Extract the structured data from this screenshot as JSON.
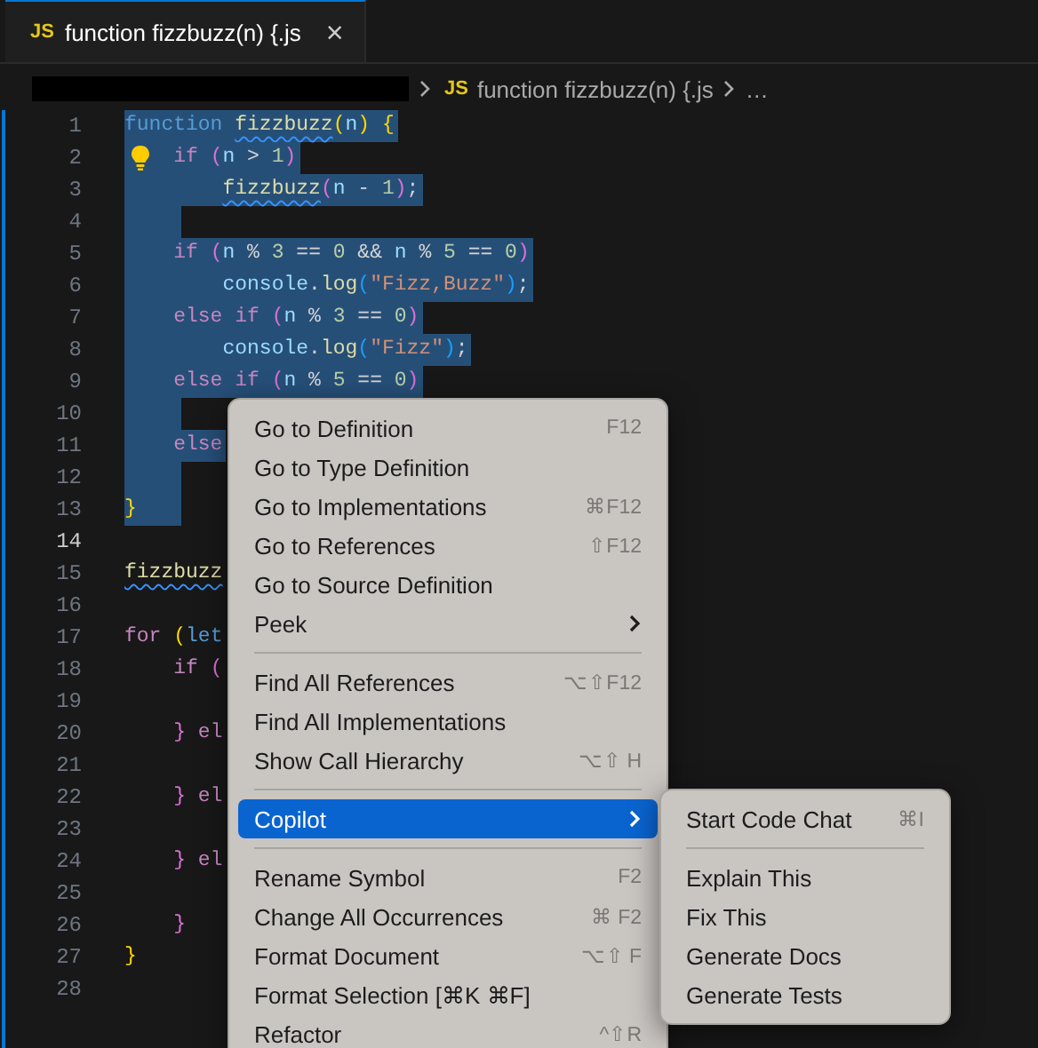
{
  "tab": {
    "icon": "JS",
    "title": "function fizzbuzz(n) {.js",
    "close": "×",
    "selected": true
  },
  "breadcrumbs": {
    "redacted": true,
    "icon": "JS",
    "file": "function fizzbuzz(n) {.js",
    "more": "…"
  },
  "lines": [
    {
      "number": "1",
      "selected": true,
      "current": false,
      "tokens": [
        {
          "text": "function ",
          "kind": "kw"
        },
        {
          "text": "fizzbuzz",
          "kind": "fn",
          "squiggle": true
        },
        {
          "text": "(",
          "kind": "p1"
        },
        {
          "text": "n",
          "kind": "var"
        },
        {
          "text": ") ",
          "kind": "p1"
        },
        {
          "text": "{",
          "kind": "p1"
        }
      ]
    },
    {
      "number": "2",
      "selected": true,
      "current": false,
      "lightbulb": true,
      "tokens": [
        {
          "text": "    if",
          "kind": "ctl"
        },
        {
          "text": " (",
          "kind": "p2"
        },
        {
          "text": "n",
          "kind": "var"
        },
        {
          "text": " > ",
          "kind": "op"
        },
        {
          "text": "1",
          "kind": "num"
        },
        {
          "text": ")",
          "kind": "p2"
        }
      ]
    },
    {
      "number": "3",
      "selected": true,
      "current": false,
      "tokens": [
        {
          "text": "        fizzbuzz",
          "kind": "fn",
          "squiggle": true
        },
        {
          "text": "(",
          "kind": "p2"
        },
        {
          "text": "n",
          "kind": "var"
        },
        {
          "text": " - ",
          "kind": "op"
        },
        {
          "text": "1",
          "kind": "num"
        },
        {
          "text": ")",
          "kind": "p2"
        },
        {
          "text": ";",
          "kind": "op"
        }
      ]
    },
    {
      "number": "4",
      "selected": true,
      "current": false
    },
    {
      "number": "5",
      "selected": true,
      "current": false,
      "tokens": [
        {
          "text": "    if",
          "kind": "ctl"
        },
        {
          "text": " (",
          "kind": "p2"
        },
        {
          "text": "n",
          "kind": "var"
        },
        {
          "text": " % ",
          "kind": "op"
        },
        {
          "text": "3",
          "kind": "num"
        },
        {
          "text": " == ",
          "kind": "op"
        },
        {
          "text": "0",
          "kind": "num"
        },
        {
          "text": " && ",
          "kind": "op"
        },
        {
          "text": "n",
          "kind": "var"
        },
        {
          "text": " % ",
          "kind": "op"
        },
        {
          "text": "5",
          "kind": "num"
        },
        {
          "text": " == ",
          "kind": "op"
        },
        {
          "text": "0",
          "kind": "num"
        },
        {
          "text": ")",
          "kind": "p2"
        }
      ]
    },
    {
      "number": "6",
      "selected": true,
      "current": false,
      "tokens": [
        {
          "text": "        console",
          "kind": "var"
        },
        {
          "text": ".",
          "kind": "op"
        },
        {
          "text": "log",
          "kind": "fn"
        },
        {
          "text": "(",
          "kind": "p3"
        },
        {
          "text": "\"Fizz,Buzz\"",
          "kind": "str"
        },
        {
          "text": ")",
          "kind": "p3"
        },
        {
          "text": ";",
          "kind": "op"
        }
      ]
    },
    {
      "number": "7",
      "selected": true,
      "current": false,
      "tokens": [
        {
          "text": "    else if",
          "kind": "ctl"
        },
        {
          "text": " (",
          "kind": "p2"
        },
        {
          "text": "n",
          "kind": "var"
        },
        {
          "text": " % ",
          "kind": "op"
        },
        {
          "text": "3",
          "kind": "num"
        },
        {
          "text": " == ",
          "kind": "op"
        },
        {
          "text": "0",
          "kind": "num"
        },
        {
          "text": ")",
          "kind": "p2"
        }
      ]
    },
    {
      "number": "8",
      "selected": true,
      "current": false,
      "tokens": [
        {
          "text": "        console",
          "kind": "var"
        },
        {
          "text": ".",
          "kind": "op"
        },
        {
          "text": "log",
          "kind": "fn"
        },
        {
          "text": "(",
          "kind": "p3"
        },
        {
          "text": "\"Fizz\"",
          "kind": "str"
        },
        {
          "text": ")",
          "kind": "p3"
        },
        {
          "text": ";",
          "kind": "op"
        }
      ]
    },
    {
      "number": "9",
      "selected": true,
      "current": false,
      "tokens": [
        {
          "text": "    else if",
          "kind": "ctl"
        },
        {
          "text": " (",
          "kind": "p2"
        },
        {
          "text": "n",
          "kind": "var"
        },
        {
          "text": " % ",
          "kind": "op"
        },
        {
          "text": "5",
          "kind": "num"
        },
        {
          "text": " == ",
          "kind": "op"
        },
        {
          "text": "0",
          "kind": "num"
        },
        {
          "text": ")",
          "kind": "p2"
        }
      ]
    },
    {
      "number": "10",
      "selected": true,
      "current": false
    },
    {
      "number": "11",
      "selected": true,
      "current": false,
      "tokens": [
        {
          "text": "    else",
          "kind": "ctl"
        }
      ]
    },
    {
      "number": "12",
      "selected": true,
      "current": false
    },
    {
      "number": "13",
      "selected": true,
      "current": false,
      "tokens": [
        {
          "text": "}",
          "kind": "p1"
        }
      ]
    },
    {
      "number": "14",
      "selected": false,
      "current": true
    },
    {
      "number": "15",
      "selected": false,
      "current": false,
      "tokens": [
        {
          "text": "fizzbuzz",
          "kind": "fn",
          "squiggle": true
        }
      ]
    },
    {
      "number": "16",
      "selected": false,
      "current": false
    },
    {
      "number": "17",
      "selected": false,
      "current": false,
      "tokens": [
        {
          "text": "for",
          "kind": "ctl"
        },
        {
          "text": " (",
          "kind": "p1"
        },
        {
          "text": "let",
          "kind": "kw"
        }
      ]
    },
    {
      "number": "18",
      "selected": false,
      "current": false,
      "tokens": [
        {
          "text": "    if",
          "kind": "ctl"
        },
        {
          "text": " (",
          "kind": "p2"
        }
      ]
    },
    {
      "number": "19",
      "selected": false,
      "current": false
    },
    {
      "number": "20",
      "selected": false,
      "current": false,
      "tokens": [
        {
          "text": "    }",
          "kind": "p2"
        },
        {
          "text": " el",
          "kind": "ctl"
        }
      ]
    },
    {
      "number": "21",
      "selected": false,
      "current": false
    },
    {
      "number": "22",
      "selected": false,
      "current": false,
      "tokens": [
        {
          "text": "    }",
          "kind": "p2"
        },
        {
          "text": " el",
          "kind": "ctl"
        }
      ]
    },
    {
      "number": "23",
      "selected": false,
      "current": false
    },
    {
      "number": "24",
      "selected": false,
      "current": false,
      "tokens": [
        {
          "text": "    }",
          "kind": "p2"
        },
        {
          "text": " el",
          "kind": "ctl"
        }
      ]
    },
    {
      "number": "25",
      "selected": false,
      "current": false
    },
    {
      "number": "26",
      "selected": false,
      "current": false,
      "tokens": [
        {
          "text": "    }",
          "kind": "p2"
        }
      ]
    },
    {
      "number": "27",
      "selected": false,
      "current": false,
      "tokens": [
        {
          "text": "}",
          "kind": "p1"
        }
      ]
    },
    {
      "number": "28",
      "selected": false,
      "current": false
    }
  ],
  "context_menu": {
    "items": [
      {
        "kind": "item",
        "label": "Go to Definition",
        "shortcut": "F12",
        "selected": false
      },
      {
        "kind": "item",
        "label": "Go to Type Definition",
        "selected": false
      },
      {
        "kind": "item",
        "label": "Go to Implementations",
        "shortcut": "⌘F12",
        "selected": false
      },
      {
        "kind": "item",
        "label": "Go to References",
        "shortcut": "⇧F12",
        "selected": false
      },
      {
        "kind": "item",
        "label": "Go to Source Definition",
        "selected": false
      },
      {
        "kind": "submenu",
        "label": "Peek",
        "selected": false
      },
      {
        "kind": "separator"
      },
      {
        "kind": "item",
        "label": "Find All References",
        "shortcut": "⌥⇧F12",
        "selected": false
      },
      {
        "kind": "item",
        "label": "Find All Implementations",
        "selected": false
      },
      {
        "kind": "item",
        "label": "Show Call Hierarchy",
        "shortcut": "⌥⇧ H",
        "selected": false
      },
      {
        "kind": "separator"
      },
      {
        "kind": "submenu",
        "label": "Copilot",
        "selected": true
      },
      {
        "kind": "separator"
      },
      {
        "kind": "item",
        "label": "Rename Symbol",
        "shortcut": "F2",
        "selected": false
      },
      {
        "kind": "item",
        "label": "Change All Occurrences",
        "shortcut": "⌘ F2",
        "selected": false
      },
      {
        "kind": "item",
        "label": "Format Document",
        "shortcut": "⌥⇧ F",
        "selected": false
      },
      {
        "kind": "item",
        "label": "Format Selection [⌘K ⌘F]",
        "selected": false
      },
      {
        "kind": "item",
        "label": "Refactor",
        "shortcut": "^⇧R",
        "selected": false
      }
    ]
  },
  "submenu": {
    "items": [
      {
        "kind": "item",
        "label": "Start Code Chat",
        "shortcut": "⌘I",
        "selected": false
      },
      {
        "kind": "separator"
      },
      {
        "kind": "item",
        "label": "Explain This",
        "selected": false
      },
      {
        "kind": "item",
        "label": "Fix This",
        "selected": false
      },
      {
        "kind": "item",
        "label": "Generate Docs",
        "selected": false
      },
      {
        "kind": "item",
        "label": "Generate Tests",
        "selected": false
      }
    ]
  }
}
